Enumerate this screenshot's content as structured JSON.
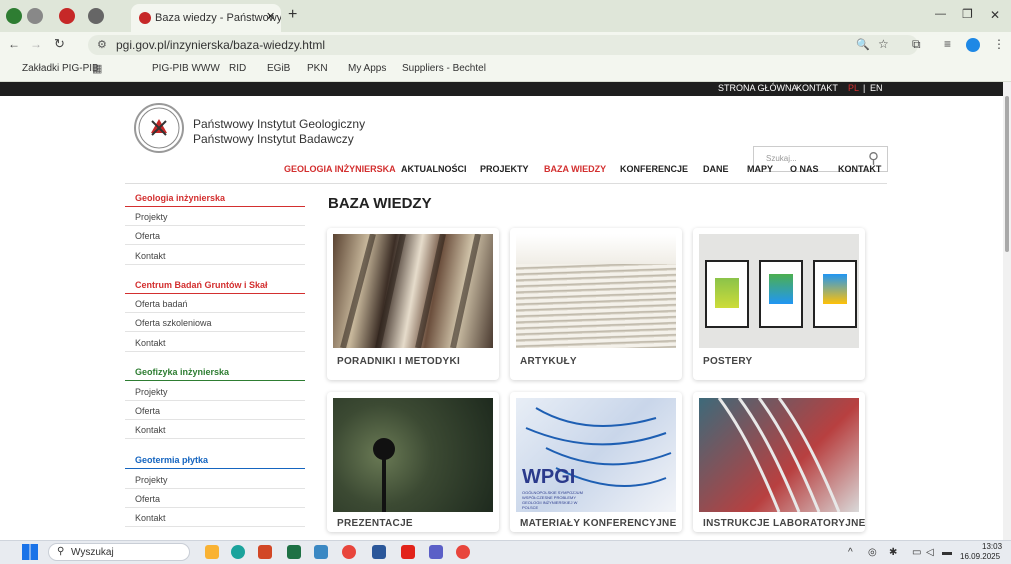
{
  "browser": {
    "tab_title": "Baza wiedzy - Państwowy Insty",
    "url": "pgi.gov.pl/inzynierska/baza-wiedzy.html",
    "new_tab": "+",
    "window_min": "—",
    "window_max": "❐",
    "window_close": "✕",
    "bookmarks": [
      "Zakładki PIG-PIB",
      "PIG-PIB WWW",
      "RID",
      "EGiB",
      "PKN",
      "My Apps",
      "Suppliers - Bechtel"
    ]
  },
  "site": {
    "top_links": {
      "home": "STRONA GŁÓWNA",
      "contact": "KONTAKT",
      "pl": "PL",
      "sep": "|",
      "en": "EN"
    },
    "institute_line1": "Państwowy Instytut Geologiczny",
    "institute_line2": "Państwowy Instytut Badawczy",
    "search_placeholder": "Szukaj...",
    "nav": [
      "GEOLOGIA INŻYNIERSKA",
      "AKTUALNOŚCI",
      "PROJEKTY",
      "BAZA WIEDZY",
      "KONFERENCJE",
      "DANE",
      "MAPY",
      "O NAS",
      "KONTAKT"
    ],
    "colors": {
      "accent_red": "#d32f2f",
      "green": "#2e7d32",
      "blue": "#1565c0"
    }
  },
  "sidebar": {
    "sections": [
      {
        "title": "Geologia inżynierska",
        "items": [
          "Projekty",
          "Oferta",
          "Kontakt"
        ]
      },
      {
        "title": "Centrum Badań Gruntów i Skał",
        "items": [
          "Oferta badań",
          "Oferta szkoleniowa",
          "Kontakt"
        ]
      },
      {
        "title": "Geofizyka inżynierska",
        "items": [
          "Projekty",
          "Oferta",
          "Kontakt"
        ]
      },
      {
        "title": "Geotermia płytka",
        "items": [
          "Projekty",
          "Oferta",
          "Kontakt"
        ]
      }
    ]
  },
  "main": {
    "title": "BAZA WIEDZY",
    "cards": [
      {
        "label": "PORADNIKI I METODYKI"
      },
      {
        "label": "ARTYKUŁY"
      },
      {
        "label": "POSTERY"
      },
      {
        "label": "PREZENTACJE"
      },
      {
        "label": "MATERIAŁY KONFERENCYJNE",
        "image_text": "WPGI",
        "image_subtext": "OGÓLNOPOLSKIE SYMPOZJUM WSPÓŁCZESNE PROBLEMY GEOLOGII INŻYNIERSKIEJ W POLSCE"
      },
      {
        "label": "INSTRUKCJE LABORATORYJNE"
      }
    ]
  },
  "taskbar": {
    "search": "Wyszukaj",
    "time": "13:03",
    "date": "16.09.2025"
  }
}
